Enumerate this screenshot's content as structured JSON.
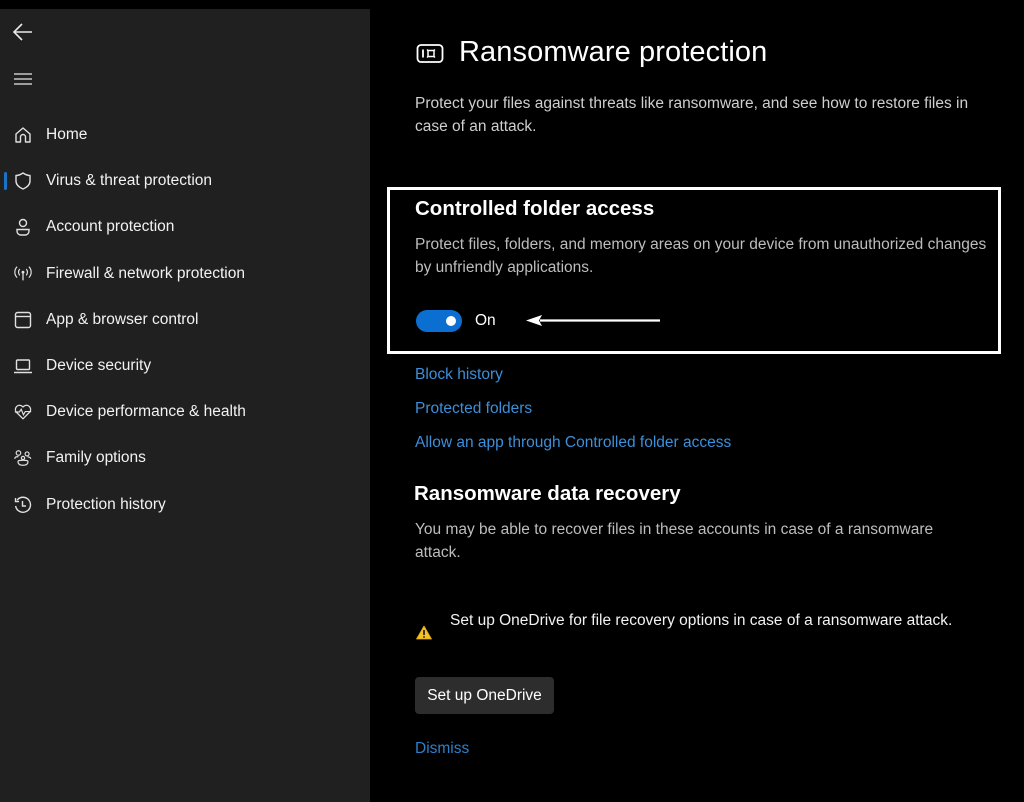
{
  "sidebar": {
    "back_icon": "arrow-left-icon",
    "menu_icon": "hamburger-menu-icon",
    "items": [
      {
        "label": "Home",
        "icon": "home-icon",
        "selected": false
      },
      {
        "label": "Virus & threat protection",
        "icon": "shield-icon",
        "selected": true
      },
      {
        "label": "Account protection",
        "icon": "person-icon",
        "selected": false
      },
      {
        "label": "Firewall & network protection",
        "icon": "antenna-icon",
        "selected": false
      },
      {
        "label": "App & browser control",
        "icon": "app-window-icon",
        "selected": false
      },
      {
        "label": "Device security",
        "icon": "laptop-icon",
        "selected": false
      },
      {
        "label": "Device performance & health",
        "icon": "heart-pulse-icon",
        "selected": false
      },
      {
        "label": "Family options",
        "icon": "family-icon",
        "selected": false
      },
      {
        "label": "Protection history",
        "icon": "history-icon",
        "selected": false
      }
    ],
    "accent_color": "#1a73c5"
  },
  "main": {
    "page_icon": "ransomware-icon",
    "title": "Ransomware protection",
    "description": "Protect your files against threats like ransomware, and see how to restore files in case of an attack.",
    "controlled_folder_access": {
      "title": "Controlled folder access",
      "description": "Protect files, folders, and memory areas on your device from unauthorized changes by unfriendly applications.",
      "toggle_state": true,
      "toggle_label": "On",
      "toggle_color": "#0a6fd1",
      "links": [
        "Block history",
        "Protected folders",
        "Allow an app through Controlled folder access"
      ]
    },
    "data_recovery": {
      "title": "Ransomware data recovery",
      "description": "You may be able to recover files in these accounts in case of a ransomware attack.",
      "warning_icon": "warning-triangle-icon",
      "warning_text": "Set up OneDrive for file recovery options in case of a ransomware attack.",
      "button_label": "Set up OneDrive",
      "dismiss_label": "Dismiss"
    },
    "link_color": "#3c8fd9"
  }
}
